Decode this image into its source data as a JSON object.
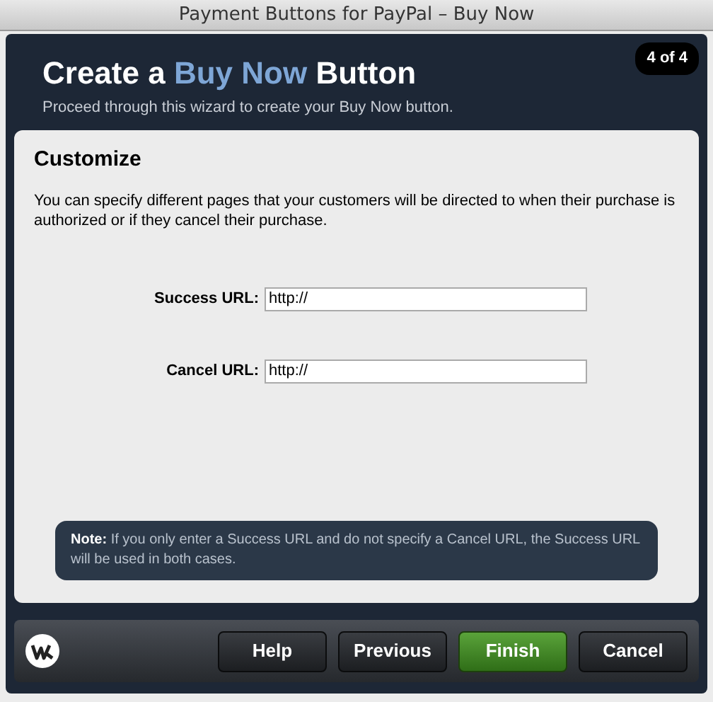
{
  "window": {
    "title": "Payment Buttons for PayPal – Buy Now"
  },
  "header": {
    "title": {
      "before": "Create a",
      "highlight": "Buy Now",
      "after": "Button"
    },
    "subtitle": "Proceed through this wizard to create your Buy Now button.",
    "step": "4 of 4"
  },
  "section": {
    "heading": "Customize",
    "description": "You can specify different pages that your customers will be directed to when their purchase is authorized or if they cancel their purchase."
  },
  "fields": [
    {
      "label": "Success URL:",
      "value": "http://"
    },
    {
      "label": "Cancel URL:",
      "value": "http://"
    }
  ],
  "note": "**Note:** If you only enter a Success URL and do not specify a Cancel URL, the Success URL will be used in both cases.",
  "buttons": [
    {
      "label": "Help",
      "kind": "normal"
    },
    {
      "label": "Previous",
      "kind": "normal"
    },
    {
      "label": "Finish",
      "kind": "primary"
    },
    {
      "label": "Cancel",
      "kind": "normal"
    }
  ]
}
